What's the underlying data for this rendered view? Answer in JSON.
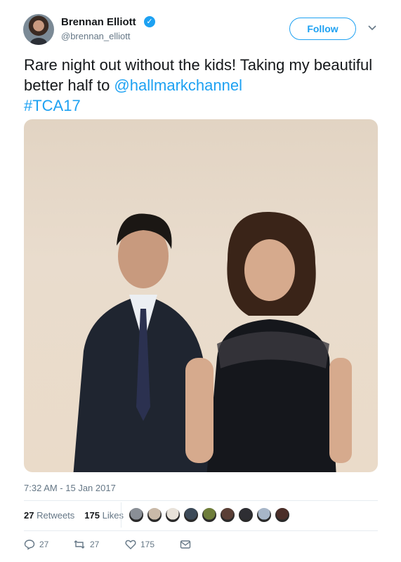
{
  "author": {
    "name": "Brennan Elliott",
    "handle": "@brennan_elliott",
    "verified": true
  },
  "follow_label": "Follow",
  "tweet": {
    "text_part1": "Rare night out without the kids! Taking my beautiful better half to ",
    "mention": "@hallmarkchannel",
    "hashtag": "#TCA17"
  },
  "photo_description": "",
  "timestamp": "7:32 AM - 15 Jan 2017",
  "stats": {
    "retweets_count": "27",
    "retweets_label": "Retweets",
    "likes_count": "175",
    "likes_label": "Likes"
  },
  "likers": [
    "#8a8f96",
    "#c9b9a8",
    "#e8e2d9",
    "#3c4a58",
    "#6e7d3a",
    "#5a3f36",
    "#2e2e33",
    "#a7b6c8",
    "#4b2e28"
  ],
  "actions": {
    "reply_count": "27",
    "retweet_count": "27",
    "like_count": "175"
  },
  "colors": {
    "accent": "#1da1f2",
    "muted": "#657786",
    "text": "#14171a"
  }
}
